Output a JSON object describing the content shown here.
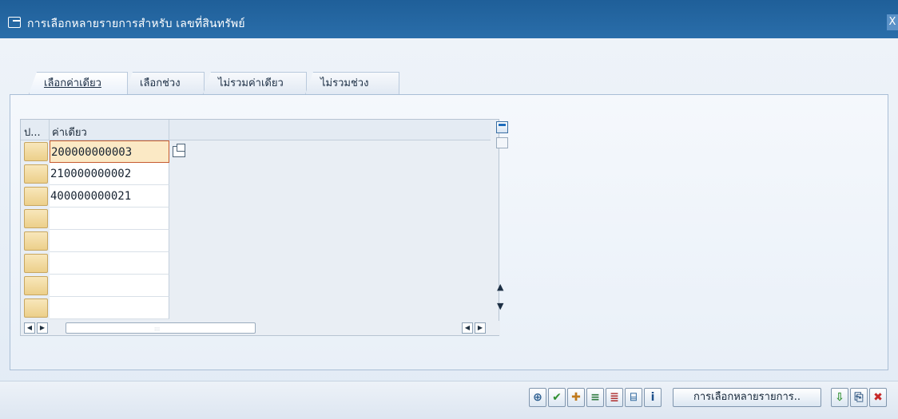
{
  "window": {
    "title": "การเลือกหลายรายการสำหรับ เลขที่สินทรัพย์",
    "close_label": "X"
  },
  "tabs": [
    {
      "label": "เลือกค่าเดียว",
      "active": true
    },
    {
      "label": "เลือกช่วง",
      "active": false
    },
    {
      "label": "ไม่รวมค่าเดียว",
      "active": false
    },
    {
      "label": "ไม่รวมช่วง",
      "active": false
    }
  ],
  "table": {
    "columns": [
      "ป...",
      "ค่าเดียว"
    ],
    "rows": [
      "200000000003",
      "210000000002",
      "400000000021",
      "",
      "",
      "",
      "",
      ""
    ]
  },
  "toolbar": {
    "multiple_selection_label": "การเลือกหลายรายการ..",
    "colors": {
      "accent": "#1f5f99",
      "selection_yellow": "#eccf8a"
    }
  }
}
